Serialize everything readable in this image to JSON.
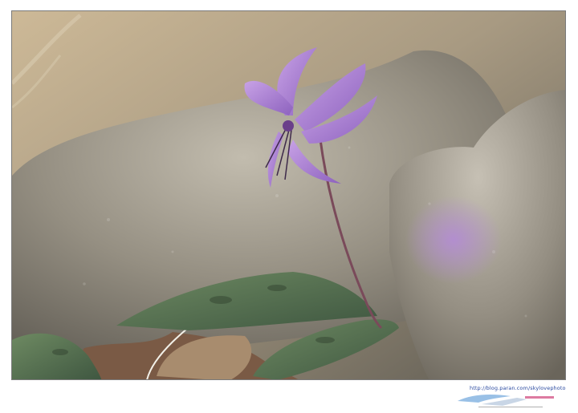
{
  "photo": {
    "subject": "katakuri-flower-photo",
    "colors": {
      "petal": "#b58ad6",
      "petal_dark": "#8a5fb8",
      "rock": "#9a9486",
      "leaf": "#4f6a4b",
      "background": "#c9b89a"
    }
  },
  "footer": {
    "url": "http://blog.paran.com/skylovephoto"
  }
}
